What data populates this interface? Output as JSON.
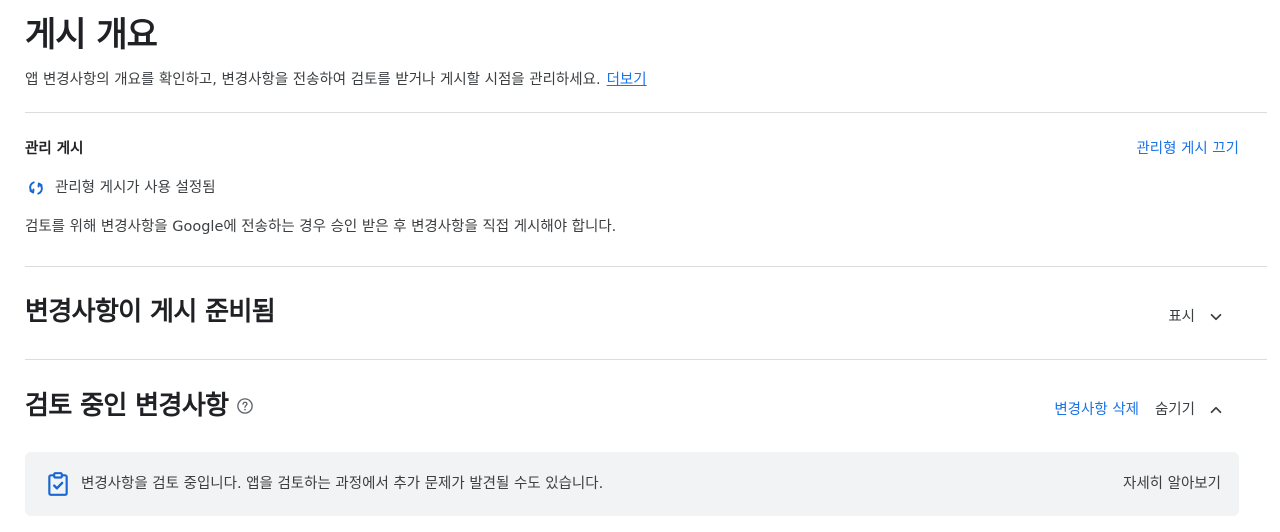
{
  "header": {
    "title": "게시 개요",
    "description": "앱 변경사항의 개요를 확인하고, 변경사항을 전송하여 검토를 받거나 게시할 시점을 관리하세요.",
    "learn_more_link": "더보기"
  },
  "managed_publishing": {
    "title": "관리 게시",
    "turn_off_link": "관리형 게시 끄기",
    "status_text": "관리형 게시가 사용 설정됨",
    "status_icon": "sync-icon",
    "note": "검토를 위해 변경사항을 Google에 전송하는 경우 승인 받은 후 변경사항을 직접 게시해야 합니다."
  },
  "ready_section": {
    "title": "변경사항이 게시 준비됨",
    "toggle_label": "표시",
    "toggle_icon": "chevron-down-icon"
  },
  "review_section": {
    "title": "검토 중인 변경사항",
    "help_icon": "help-icon",
    "delete_link": "변경사항 삭제",
    "toggle_label": "숨기기",
    "toggle_icon": "chevron-up-icon"
  },
  "review_banner": {
    "icon": "clipboard-check-icon",
    "text": "변경사항을 검토 중입니다. 앱을 검토하는 과정에서 추가 문제가 발견될 수도 있습니다.",
    "learn_more_link": "자세히 알아보기"
  },
  "colors": {
    "link": "#1a73e8",
    "icon_blue": "#1967d2",
    "divider": "#dadce0",
    "banner_bg": "#f1f3f4"
  }
}
